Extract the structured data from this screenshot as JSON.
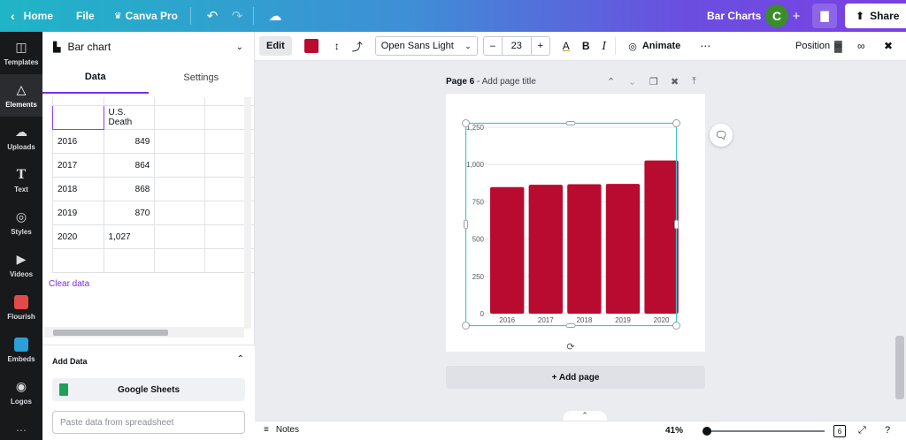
{
  "topbar": {
    "home_label": "Home",
    "file_label": "File",
    "canva_pro_label": "Canva Pro",
    "doc_title": "Bar Charts",
    "avatar_initial": "C",
    "share_label": "Share"
  },
  "rail": {
    "items": [
      {
        "label": "Templates",
        "icon": "templates-icon"
      },
      {
        "label": "Elements",
        "icon": "elements-icon"
      },
      {
        "label": "Uploads",
        "icon": "uploads-icon"
      },
      {
        "label": "Text",
        "icon": "text-icon"
      },
      {
        "label": "Styles",
        "icon": "styles-icon"
      },
      {
        "label": "Videos",
        "icon": "videos-icon"
      },
      {
        "label": "Flourish",
        "icon": "flourish-icon"
      },
      {
        "label": "Embeds",
        "icon": "embeds-icon"
      },
      {
        "label": "Logos",
        "icon": "logos-icon"
      }
    ]
  },
  "panel": {
    "chart_type": "Bar chart",
    "tabs": [
      "Data",
      "Settings"
    ],
    "table": {
      "header": [
        "",
        "U.S. Death",
        "",
        ""
      ],
      "rows": [
        [
          "2016",
          "849",
          "",
          ""
        ],
        [
          "2017",
          "864",
          "",
          ""
        ],
        [
          "2018",
          "868",
          "",
          ""
        ],
        [
          "2019",
          "870",
          "",
          ""
        ],
        [
          "2020",
          "1,027",
          "",
          ""
        ],
        [
          "",
          "",
          "",
          ""
        ]
      ]
    },
    "clear_data": "Clear data",
    "add_data_title": "Add Data",
    "google_sheets": "Google Sheets",
    "paste_placeholder": "Paste data from spreadsheet"
  },
  "toolbar": {
    "edit_label": "Edit",
    "color_swatch": "#b80b2f",
    "font_name": "Open Sans Light",
    "font_size": "23",
    "animate_label": "Animate",
    "position_label": "Position"
  },
  "canvas": {
    "page_label": "Page 6",
    "page_title_placeholder": "Add page title",
    "add_page": "+ Add page"
  },
  "bottombar": {
    "notes_label": "Notes",
    "zoom": "41%",
    "page_count": "6"
  },
  "chart_data": {
    "type": "bar",
    "categories": [
      "2016",
      "2017",
      "2018",
      "2019",
      "2020"
    ],
    "values": [
      849,
      864,
      868,
      870,
      1027
    ],
    "ylim": [
      0,
      1250
    ],
    "yticks": [
      "0",
      "250",
      "500",
      "750",
      "1,000",
      "1,250"
    ],
    "bar_color": "#b80b2f",
    "grid": true
  }
}
